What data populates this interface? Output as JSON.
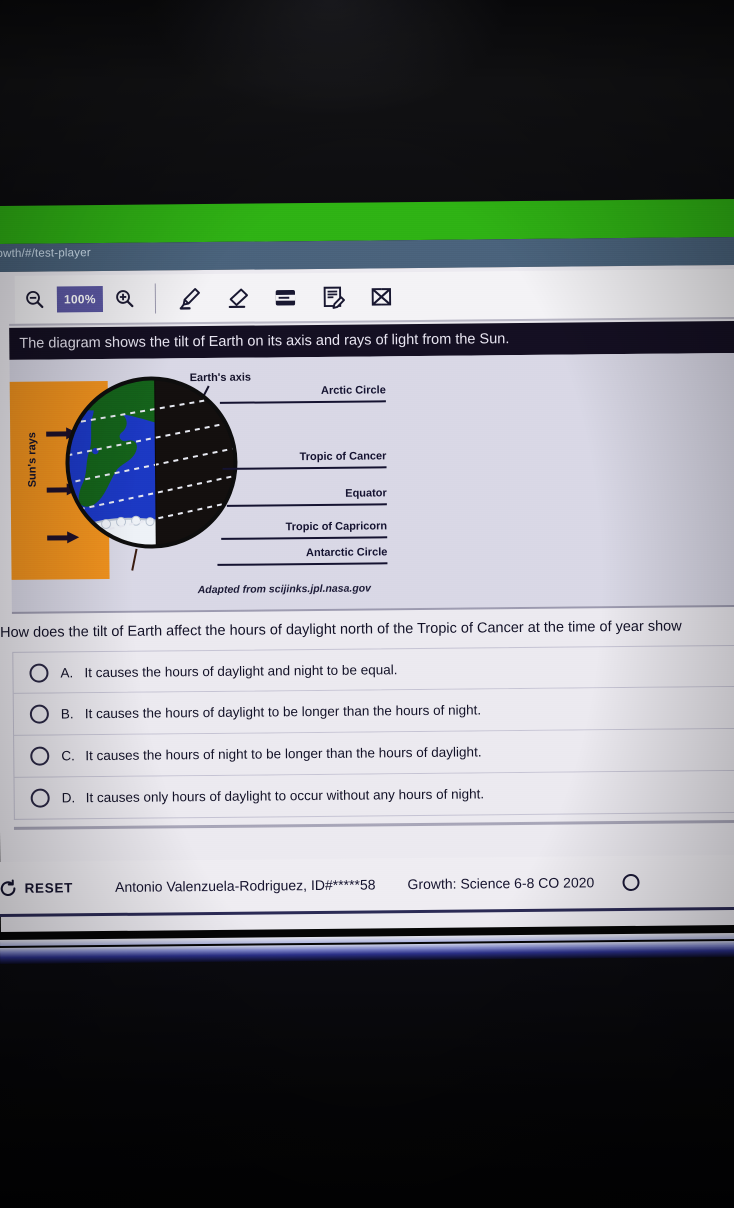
{
  "browser": {
    "url_fragment": "owth/#/test-player"
  },
  "toolbar": {
    "zoom_out_icon": "magnifier-minus-icon",
    "zoom_level": "100%",
    "zoom_in_icon": "magnifier-plus-icon",
    "tools": [
      {
        "name": "highlighter-tool",
        "icon": "highlighter-icon"
      },
      {
        "name": "eraser-tool",
        "icon": "eraser-icon"
      },
      {
        "name": "line-reader-tool",
        "icon": "line-reader-icon"
      },
      {
        "name": "notepad-tool",
        "icon": "notepad-pencil-icon"
      },
      {
        "name": "answer-eliminator-tool",
        "icon": "crossed-out-icon"
      }
    ]
  },
  "stimulus": {
    "banner_text": "The diagram shows the tilt of Earth on its axis and rays of light from the Sun.",
    "diagram": {
      "axis_label": "Earth's axis",
      "sun_label": "Sun's rays",
      "ray_count": 3,
      "latitude_labels": [
        "Arctic Circle",
        "Tropic of Cancer",
        "Equator",
        "Tropic of Capricorn",
        "Antarctic Circle"
      ],
      "credit": "Adapted from scijinks.jpl.nasa.gov",
      "colors": {
        "sun_panel": "#f0921e",
        "land_lit": "#14631a",
        "ocean_lit": "#1b38c4",
        "night_side": "#140f0d",
        "ice": "#eef2f7"
      }
    }
  },
  "question": {
    "text": "How does the tilt of Earth affect the hours of daylight north of the Tropic of Cancer at the time of year show",
    "choices": [
      {
        "letter": "A.",
        "text": "It causes the hours of daylight and night to be equal.",
        "selected": false
      },
      {
        "letter": "B.",
        "text": "It causes the hours of daylight to be longer than the hours of night.",
        "selected": false
      },
      {
        "letter": "C.",
        "text": "It causes the hours of night to be longer than the hours of daylight.",
        "selected": false
      },
      {
        "letter": "D.",
        "text": "It causes only hours of daylight to occur without any hours of night.",
        "selected": false
      }
    ]
  },
  "footer": {
    "reset_label": "RESET",
    "reset_icon": "refresh-circle-icon",
    "student": "Antonio Valenzuela-Rodriguez, ID#*****58",
    "test_name": "Growth: Science 6-8 CO 2020"
  }
}
